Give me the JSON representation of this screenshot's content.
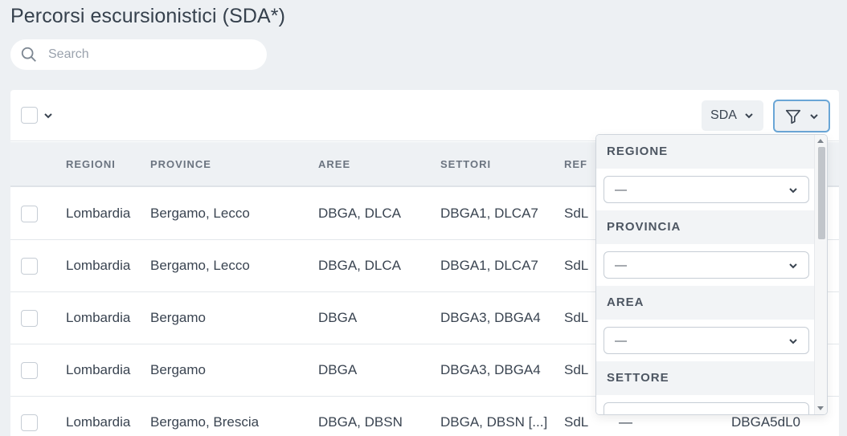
{
  "page": {
    "title": "Percorsi escursionistici (SDA*)"
  },
  "search": {
    "placeholder": "Search"
  },
  "toolbar": {
    "sda_label": "SDA"
  },
  "table": {
    "columns": [
      "REGIONI",
      "PROVINCE",
      "AREE",
      "SETTORI",
      "REF"
    ],
    "rows": [
      {
        "regioni": "Lombardia",
        "province": "Bergamo, Lecco",
        "aree": "DBGA, DLCA",
        "settori": "DBGA1, DLCA7",
        "ref": "SdL"
      },
      {
        "regioni": "Lombardia",
        "province": "Bergamo, Lecco",
        "aree": "DBGA, DLCA",
        "settori": "DBGA1, DLCA7",
        "ref": "SdL"
      },
      {
        "regioni": "Lombardia",
        "province": "Bergamo",
        "aree": "DBGA",
        "settori": "DBGA3, DBGA4",
        "ref": "SdL"
      },
      {
        "regioni": "Lombardia",
        "province": "Bergamo",
        "aree": "DBGA",
        "settori": "DBGA3, DBGA4",
        "ref": "SdL"
      },
      {
        "regioni": "Lombardia",
        "province": "Bergamo, Brescia",
        "aree": "DBGA, DBSN",
        "settori": "DBGA, DBSN [...]",
        "ref": "SdL",
        "extra1": "—",
        "extra2": "DBGA5dL0"
      }
    ]
  },
  "filters": {
    "sections": [
      {
        "label": "REGIONE",
        "value": "—"
      },
      {
        "label": "PROVINCIA",
        "value": "—"
      },
      {
        "label": "AREA",
        "value": "—"
      },
      {
        "label": "SETTORE",
        "value": "—"
      }
    ]
  },
  "colors": {
    "accent": "#6aa6d6",
    "background": "#edf0f3"
  }
}
